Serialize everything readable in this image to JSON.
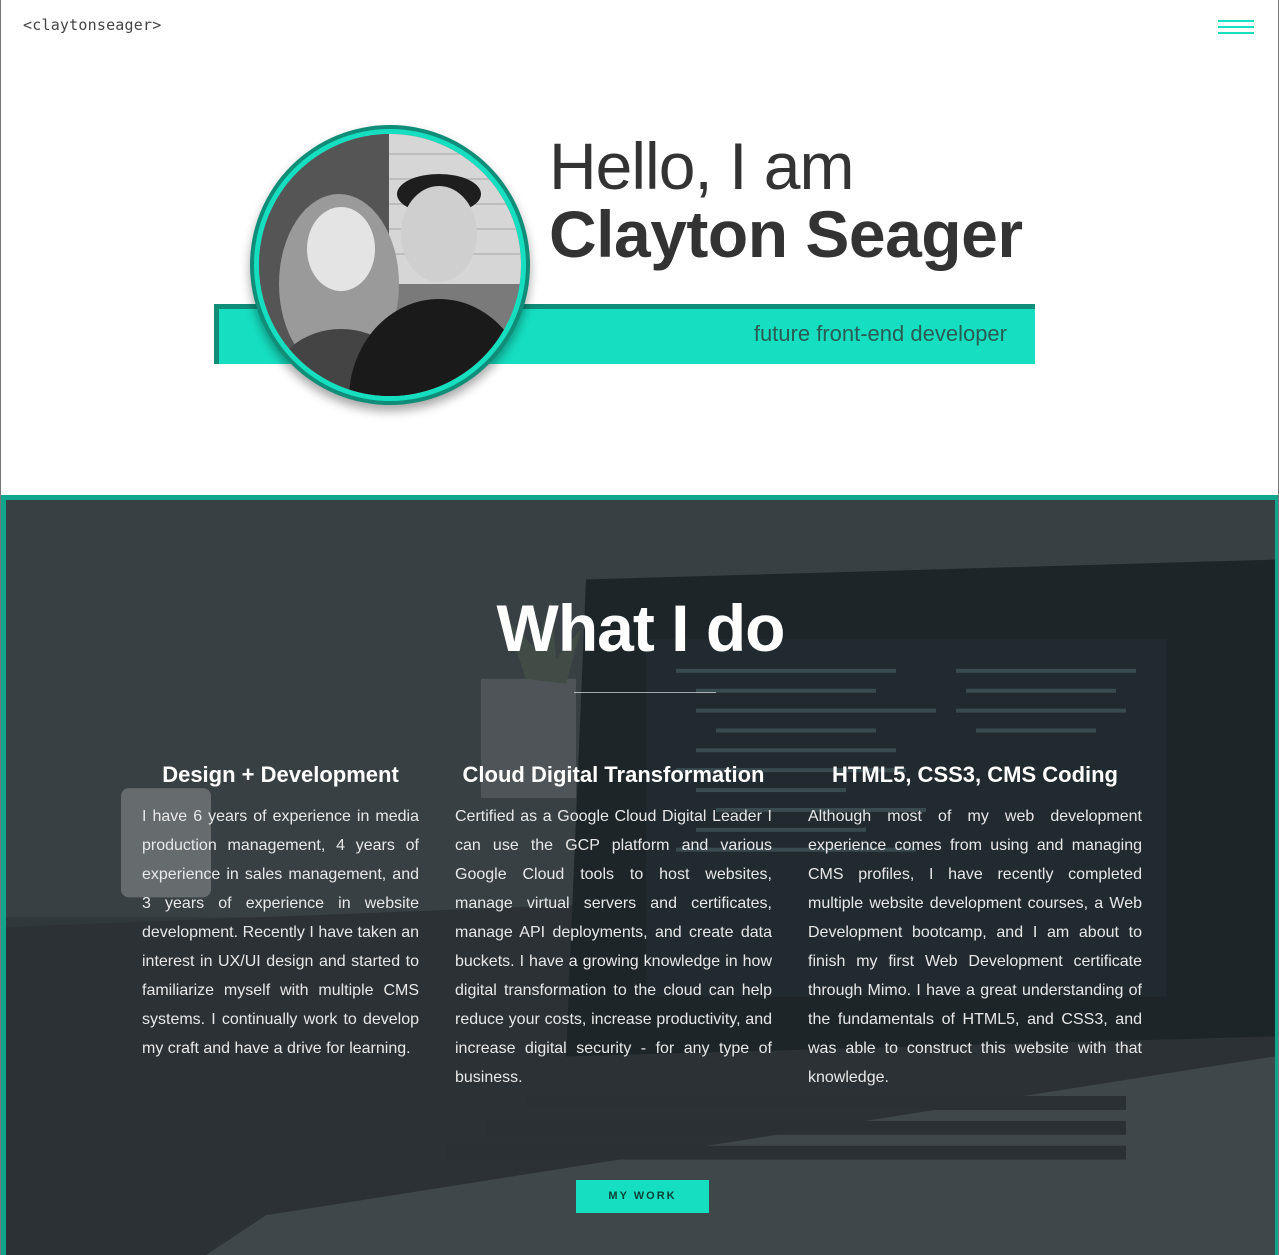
{
  "header": {
    "logo": "<claytonseager>",
    "menu_icon": "hamburger-menu-icon"
  },
  "hero": {
    "greeting": "Hello, I am",
    "name": "Clayton Seager",
    "subtitle": "future front-end developer",
    "avatar_icon": "profile-photo"
  },
  "what_i_do": {
    "title": "What I do",
    "columns": [
      {
        "heading": "Design + Development",
        "text": "I have 6 years of experience in media production management, 4 years of experience in sales management, and 3 years of experience in website development. Recently I have taken an interest in UX/UI design and started to familiarize myself with multiple CMS systems. I continually work to develop my craft and have a drive for learning."
      },
      {
        "heading": "Cloud Digital Transformation",
        "text": "Certified as a Google Cloud Digital Leader I can use the GCP platform and various Google Cloud tools to host websites, manage virtual servers and certificates, manage API deployments, and create data buckets. I have a growing knowledge in how digital transformation to the cloud can help reduce your costs, increase productivity, and increase digital security - for any type of business."
      },
      {
        "heading": "HTML5, CSS3, CMS Coding",
        "text": "Although most of my web development experience comes from using and managing CMS profiles, I have recently completed multiple website development courses, a Web Development bootcamp, and I am about to finish my first Web Development certificate through Mimo. I have a great understanding of the fundamentals of HTML5, and CSS3, and was able to construct this website with that knowledge."
      }
    ],
    "button_label": "MY WORK"
  },
  "colors": {
    "accent": "#16dfc1",
    "accent_dark": "#0f8d78",
    "text": "#333333"
  }
}
